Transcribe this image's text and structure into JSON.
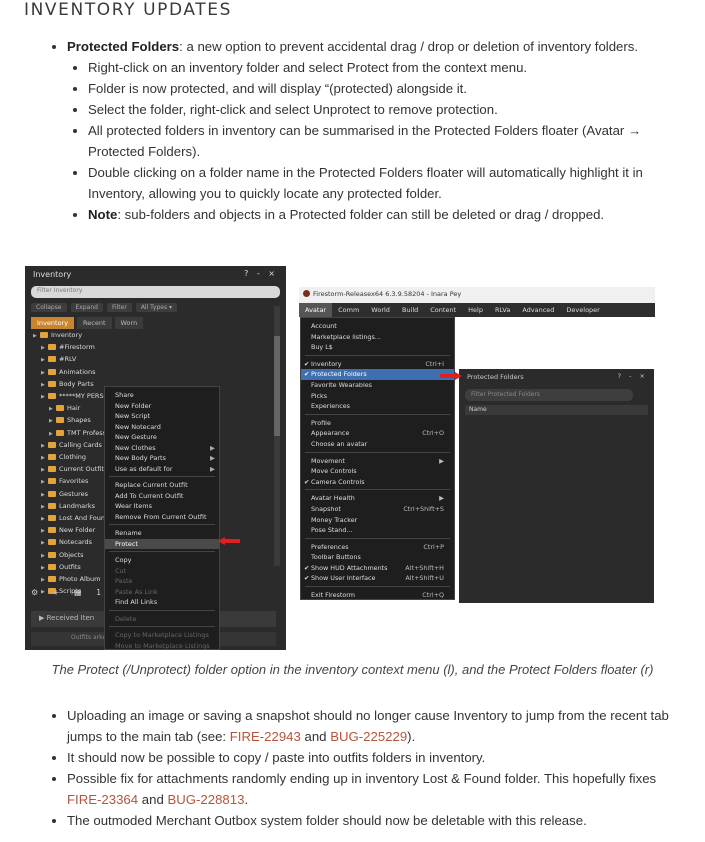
{
  "heading": "INVENTORY UPDATES",
  "top_list": {
    "protected_title": "Protected Folders",
    "protected_text": ": a new option to prevent accidental drag / drop or deletion of inventory folders.",
    "sub_items": [
      "Right-click on an inventory folder and select Protect from the context menu.",
      "Folder is now protected, and will display “(protected) alongside it.",
      "Select the folder, right-click and select Unprotect to remove protection.",
      "All protected folders in inventory can be summarised in the Protected Folders floater (Avatar → Protected Folders).",
      "Double clicking on a folder name in the Protected Folders floater will automatically highlight it in Inventory, allowing you to quickly locate any protected folder."
    ],
    "note_label": "Note",
    "note_text": ": sub-folders and objects in a Protected folder can still be deleted or drag / dropped."
  },
  "inventory_window": {
    "title": "Inventory",
    "controls": "? - ×",
    "filter_placeholder": "Filter Inventory",
    "toolbar": [
      "Collapse",
      "Expand",
      "Filter",
      "All Types ▾"
    ],
    "tabs": [
      "Inventory",
      "Recent",
      "Worn"
    ],
    "tree": [
      {
        "label": "Inventory",
        "indent": 0
      },
      {
        "label": "#Firestorm",
        "indent": 1
      },
      {
        "label": "#RLV",
        "indent": 1
      },
      {
        "label": "Animations",
        "indent": 1
      },
      {
        "label": "Body Parts",
        "indent": 1
      },
      {
        "label": "*****MY PERSONAL STUFF*****",
        "indent": 1
      },
      {
        "label": "Hair",
        "indent": 2
      },
      {
        "label": "Shapes",
        "indent": 2
      },
      {
        "label": "TMT Professi",
        "indent": 2
      },
      {
        "label": "Calling Cards",
        "indent": 1
      },
      {
        "label": "Clothing",
        "indent": 1
      },
      {
        "label": "Current Outfit",
        "indent": 1
      },
      {
        "label": "Favorites",
        "indent": 1
      },
      {
        "label": "Gestures",
        "indent": 1
      },
      {
        "label": "Landmarks",
        "indent": 1
      },
      {
        "label": "Lost And Foun",
        "indent": 1
      },
      {
        "label": "New Folder",
        "indent": 1
      },
      {
        "label": "Notecards",
        "indent": 1
      },
      {
        "label": "Objects",
        "indent": 1
      },
      {
        "label": "Outfits",
        "indent": 1
      },
      {
        "label": "Photo Album",
        "indent": 1
      },
      {
        "label": "Scripts",
        "indent": 1
      }
    ],
    "bottom_icons": "⚙ + ▦ 10",
    "received_label": "▶ Received Iten",
    "received2": "Outfits                        arketplace"
  },
  "context_menu": [
    {
      "label": "Share"
    },
    {
      "label": "New Folder"
    },
    {
      "label": "New Script"
    },
    {
      "label": "New Notecard"
    },
    {
      "label": "New Gesture"
    },
    {
      "label": "New Clothes",
      "arrow": true
    },
    {
      "label": "New Body Parts",
      "arrow": true
    },
    {
      "label": "Use as default for",
      "arrow": true
    },
    {
      "sep": true
    },
    {
      "label": "Replace Current Outfit"
    },
    {
      "label": "Add To Current Outfit"
    },
    {
      "label": "Wear Items"
    },
    {
      "label": "Remove From Current Outfit"
    },
    {
      "sep": true
    },
    {
      "label": "Rename"
    },
    {
      "label": "Protect",
      "hl": true
    },
    {
      "sep": true
    },
    {
      "label": "Copy"
    },
    {
      "label": "Cut",
      "dim": true
    },
    {
      "label": "Paste",
      "dim": true
    },
    {
      "label": "Paste As Link",
      "dim": true
    },
    {
      "label": "Find All Links"
    },
    {
      "sep": true
    },
    {
      "label": "Delete",
      "dim": true
    },
    {
      "sep": true
    },
    {
      "label": "Copy to Marketplace Listings",
      "dim": true
    },
    {
      "label": "Move to Marketplace Listings",
      "dim": true
    }
  ],
  "firestorm": {
    "title": "Firestorm-Releasex64 6.3.9.58204 - Inara Pey",
    "menubar": [
      "Avatar",
      "Comm",
      "World",
      "Build",
      "Content",
      "Help",
      "RLVa",
      "Advanced",
      "Developer"
    ],
    "avatar_menu": [
      {
        "label": "Account"
      },
      {
        "label": "Marketplace listings..."
      },
      {
        "label": "Buy L$"
      },
      {
        "sep": true
      },
      {
        "label": "Inventory",
        "check": true,
        "shortcut": "Ctrl+I"
      },
      {
        "label": "Protected Folders",
        "check": true,
        "hl": true
      },
      {
        "label": "Favorite Wearables"
      },
      {
        "label": "Picks"
      },
      {
        "label": "Experiences"
      },
      {
        "sep": true
      },
      {
        "label": "Profile"
      },
      {
        "label": "Appearance",
        "shortcut": "Ctrl+O"
      },
      {
        "label": "Choose an avatar"
      },
      {
        "sep": true
      },
      {
        "label": "Movement",
        "shortcut": "▶"
      },
      {
        "label": "Move Controls"
      },
      {
        "label": "Camera Controls",
        "check": true
      },
      {
        "sep": true
      },
      {
        "label": "Avatar Health",
        "shortcut": "▶"
      },
      {
        "label": "Snapshot",
        "shortcut": "Ctrl+Shift+S"
      },
      {
        "label": "Money Tracker"
      },
      {
        "label": "Pose Stand..."
      },
      {
        "sep": true
      },
      {
        "label": "Preferences",
        "shortcut": "Ctrl+P"
      },
      {
        "label": "Toolbar Buttons"
      },
      {
        "label": "Show HUD Attachments",
        "check": true,
        "shortcut": "Alt+Shift+H"
      },
      {
        "label": "Show User Interface",
        "check": true,
        "shortcut": "Alt+Shift+U"
      },
      {
        "sep": true
      },
      {
        "label": "Exit Firestorm",
        "shortcut": "Ctrl+Q"
      }
    ],
    "floater": {
      "title": "Protected Folders",
      "controls": "? - ×",
      "filter_placeholder": "Filter Protected Folders",
      "column": "Name"
    }
  },
  "caption": "The Protect (/Unprotect) folder option in the inventory context menu (l), and the Protect Folders floater (r)",
  "bottom_list": {
    "item1_pre": "Uploading an image or saving a snapshot should no longer cause Inventory to jump from the recent tab jumps to the main tab (see: ",
    "item1_link1": "FIRE-22943",
    "item1_mid": " and ",
    "item1_link2": "BUG-225229",
    "item1_post": ").",
    "item2": "It should now be possible to copy / paste into outfits folders in inventory.",
    "item3_pre": "Possible fix for attachments randomly ending up in inventory Lost & Found folder. This hopefully fixes ",
    "item3_link1": "FIRE-23364",
    "item3_mid": " and ",
    "item3_link2": "BUG-228813",
    "item3_post": ".",
    "item4": "The outmoded Merchant Outbox system folder should now be deletable with this release."
  },
  "colors": {
    "link": "#b5543c",
    "highlight_orange": "#c9852e",
    "arrow_red": "#e02020"
  }
}
